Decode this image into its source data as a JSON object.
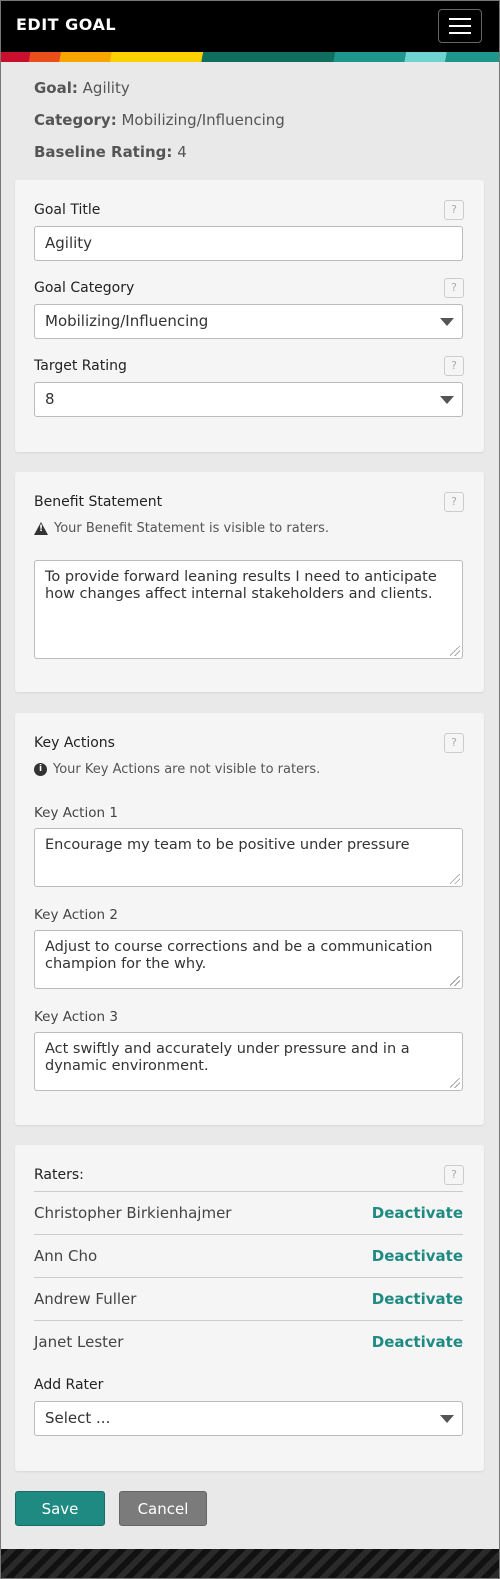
{
  "header": {
    "title": "EDIT GOAL",
    "menu_icon": "hamburger-menu-icon"
  },
  "summary": {
    "goal_label": "Goal:",
    "goal_value": "Agility",
    "category_label": "Category:",
    "category_value": "Mobilizing/Influencing",
    "baseline_label": "Baseline Rating:",
    "baseline_value": "4"
  },
  "goal_form": {
    "title_label": "Goal Title",
    "title_value": "Agility",
    "category_label": "Goal Category",
    "category_value": "Mobilizing/Influencing",
    "target_label": "Target Rating",
    "target_value": "8",
    "help": "?"
  },
  "benefit": {
    "label": "Benefit Statement",
    "note": "Your Benefit Statement is visible to raters.",
    "value": "To provide forward leaning results I need to anticipate how changes affect internal stakeholders and clients."
  },
  "key_actions": {
    "label": "Key Actions",
    "note": "Your Key Actions are not visible to raters.",
    "items": [
      {
        "label": "Key Action 1",
        "value": "Encourage my team to be positive under pressure"
      },
      {
        "label": "Key Action 2",
        "value": "Adjust to course corrections and be a communication champion for the why."
      },
      {
        "label": "Key Action 3",
        "value": "Act swiftly and accurately under pressure and in a dynamic environment."
      }
    ]
  },
  "raters": {
    "label": "Raters:",
    "list": [
      {
        "name": "Christopher Birkienhajmer",
        "action": "Deactivate"
      },
      {
        "name": "Ann Cho",
        "action": "Deactivate"
      },
      {
        "name": "Andrew Fuller",
        "action": "Deactivate"
      },
      {
        "name": "Janet Lester",
        "action": "Deactivate"
      }
    ],
    "add_label": "Add Rater",
    "add_placeholder": "Select ..."
  },
  "actions": {
    "save": "Save",
    "cancel": "Cancel"
  },
  "colors": {
    "accent": "#1f8a82",
    "header": "#000000"
  }
}
